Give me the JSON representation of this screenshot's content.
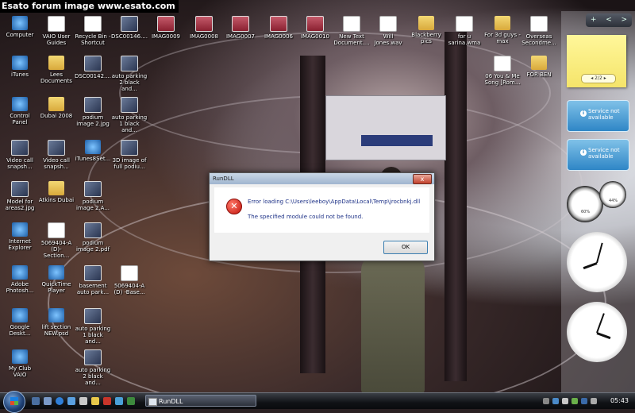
{
  "watermark": "Esato forum image www.esato.com",
  "desktop_icons": [
    {
      "label": "Computer",
      "kind": "prog"
    },
    {
      "label": "VAIO User Guides",
      "kind": "doc"
    },
    {
      "label": "Recycle Bin - Shortcut",
      "kind": "doc"
    },
    {
      "label": "DSC00146....",
      "kind": "pic"
    },
    {
      "label": "IMAG0009",
      "kind": "red"
    },
    {
      "label": "IMAG0008",
      "kind": "red"
    },
    {
      "label": "IMAG0007",
      "kind": "red"
    },
    {
      "label": "IMAG0006",
      "kind": "red"
    },
    {
      "label": "IMAG0010",
      "kind": "red"
    },
    {
      "label": "New Text Document....",
      "kind": "doc"
    },
    {
      "label": "Will Jones.wav",
      "kind": "wav"
    },
    {
      "label": "Blackberry pics",
      "kind": "folder"
    },
    {
      "label": "for u sarina.wma",
      "kind": "wav"
    },
    {
      "label": "For 3d guys - max",
      "kind": "folder"
    },
    {
      "label": "Overseas Secondme...",
      "kind": "doc"
    },
    {
      "label": "iTunes",
      "kind": "prog"
    },
    {
      "label": "Lees Documents",
      "kind": "folder"
    },
    {
      "label": "DSC00142....",
      "kind": "pic"
    },
    {
      "label": "auto parking 2 black and...",
      "kind": "pic"
    },
    {
      "label": "06 You & Me Song [Rom...",
      "kind": "wav"
    },
    {
      "label": "FOR BEN",
      "kind": "folder"
    },
    {
      "label": "Control Panel",
      "kind": "prog"
    },
    {
      "label": "Dubai 2008",
      "kind": "folder"
    },
    {
      "label": "podium image 2.jpg",
      "kind": "pic"
    },
    {
      "label": "auto parking 1 black and...",
      "kind": "pic"
    },
    {
      "label": "Video call snapsh...",
      "kind": "pic"
    },
    {
      "label": "Video call snapsh...",
      "kind": "pic"
    },
    {
      "label": "iTunes8Set...",
      "kind": "prog"
    },
    {
      "label": "3D image of full podiu...",
      "kind": "pic"
    },
    {
      "label": "Model for areas2.jpg",
      "kind": "pic"
    },
    {
      "label": "Atkins Dubai",
      "kind": "folder"
    },
    {
      "label": "podium image 2.A...",
      "kind": "pic"
    },
    {
      "label": "Internet Explorer",
      "kind": "prog"
    },
    {
      "label": "5069404-A (D)-Section...",
      "kind": "doc"
    },
    {
      "label": "podium image 2.pdf",
      "kind": "pic"
    },
    {
      "label": "Adobe Photosh...",
      "kind": "prog"
    },
    {
      "label": "QuickTime Player",
      "kind": "prog"
    },
    {
      "label": "basement auto park...",
      "kind": "pic"
    },
    {
      "label": "5069404-A (D) -Base...",
      "kind": "doc"
    },
    {
      "label": "Google Deskt...",
      "kind": "prog"
    },
    {
      "label": "lift section NEW.psd",
      "kind": "prog"
    },
    {
      "label": "auto parking 1 black and...",
      "kind": "pic"
    },
    {
      "label": "My Club VAIO",
      "kind": "prog"
    },
    {
      "label": "auto parking 2 black and...",
      "kind": "pic"
    }
  ],
  "dialog": {
    "title": "RunDLL",
    "close": "x",
    "error_icon": "error-icon",
    "message_line1": "Error loading C:\\Users\\leeboy\\AppData\\Local\\Temp\\jrocbnkj.dll",
    "message_line2": "The specified module could not be found.",
    "ok_label": "OK"
  },
  "sidebar": {
    "controls": [
      "+",
      "<",
      ">"
    ],
    "note_pager": "2/2",
    "feeds": [
      "Service not available",
      "Service not available"
    ],
    "gauge_cpu_label": "60%",
    "gauge_mem_label": "44%"
  },
  "taskbar": {
    "task_button": "RunDLL",
    "time": "05:43"
  },
  "colors": {
    "dialog_text": "#1e3287",
    "feed_blue": "#2f86c6",
    "note_yellow": "#fff79a"
  }
}
